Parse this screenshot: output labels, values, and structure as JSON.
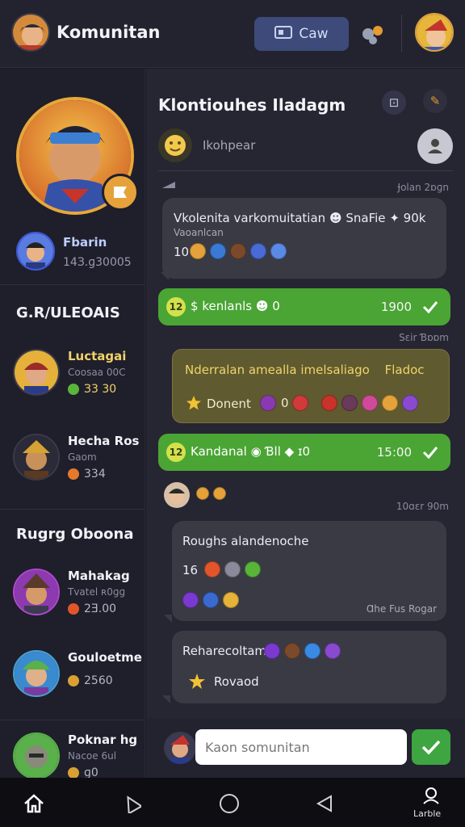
{
  "topbar": {
    "title": "Komunitan",
    "clan_button": "Caw"
  },
  "sidebar": {
    "me": {
      "name": "Fbarin",
      "score": "14З.ɡ30005"
    },
    "section1_title": "G.R/ULEOAIS",
    "friends1": [
      {
        "name": "Luctagai",
        "sub": "Coosaa 00C",
        "points": "З3 30",
        "color": "#58b53a"
      },
      {
        "name": "Hecha Ros",
        "sub": "Gaom",
        "points": "334",
        "color": "#e57a2a"
      }
    ],
    "section2_title": "Rugrg Oboona",
    "friends2": [
      {
        "name": "Mahakag",
        "sub": "Tvatel ʀ0ɡɡ",
        "points": "2Ǝ.00",
        "color": "#e2552b"
      },
      {
        "name": "Gouloetme",
        "sub": "",
        "points": "2560",
        "color": "#d9a132"
      },
      {
        "name": "Poknar hg",
        "sub": "Nacoe 6ul",
        "points": "ɡ0",
        "color": "#d9a132"
      }
    ]
  },
  "chat": {
    "title": "Klontiouhes Iladagm",
    "search_text": "Ikohpear",
    "messages": [
      {
        "time": "Ɉolan 2ɒɡn",
        "text": "Vkolenita varkomuitatian",
        "extra": "SnaFie",
        "extra2": "90k",
        "sub": "Vaoanlcan",
        "count": "10"
      },
      {
        "green": true,
        "text": "kenlanls",
        "count": "0",
        "time": "1900",
        "coins": "$"
      },
      {
        "time": "Sɛir Ɓɒɒm"
      },
      {
        "gold": true,
        "text": "Nderralan amealla imelsaliago",
        "extra": "Fladoc",
        "sub": "Donent",
        "count": "0"
      },
      {
        "green": true,
        "text": "Kandanal",
        "extra": "Ɓll",
        "extra2": "ɪ0",
        "time": "15:00"
      },
      {
        "time": "10ɑɛr 90m"
      },
      {
        "text": "Roughs alandenoche",
        "count": "16",
        "foot": "Ɑhe Fus Rogar"
      },
      {
        "text": "Reharecoltam",
        "sub": "Rovaod"
      }
    ]
  },
  "composer": {
    "placeholder": "Kaon somunitan"
  },
  "nav": {
    "profile_label": "Larble"
  }
}
